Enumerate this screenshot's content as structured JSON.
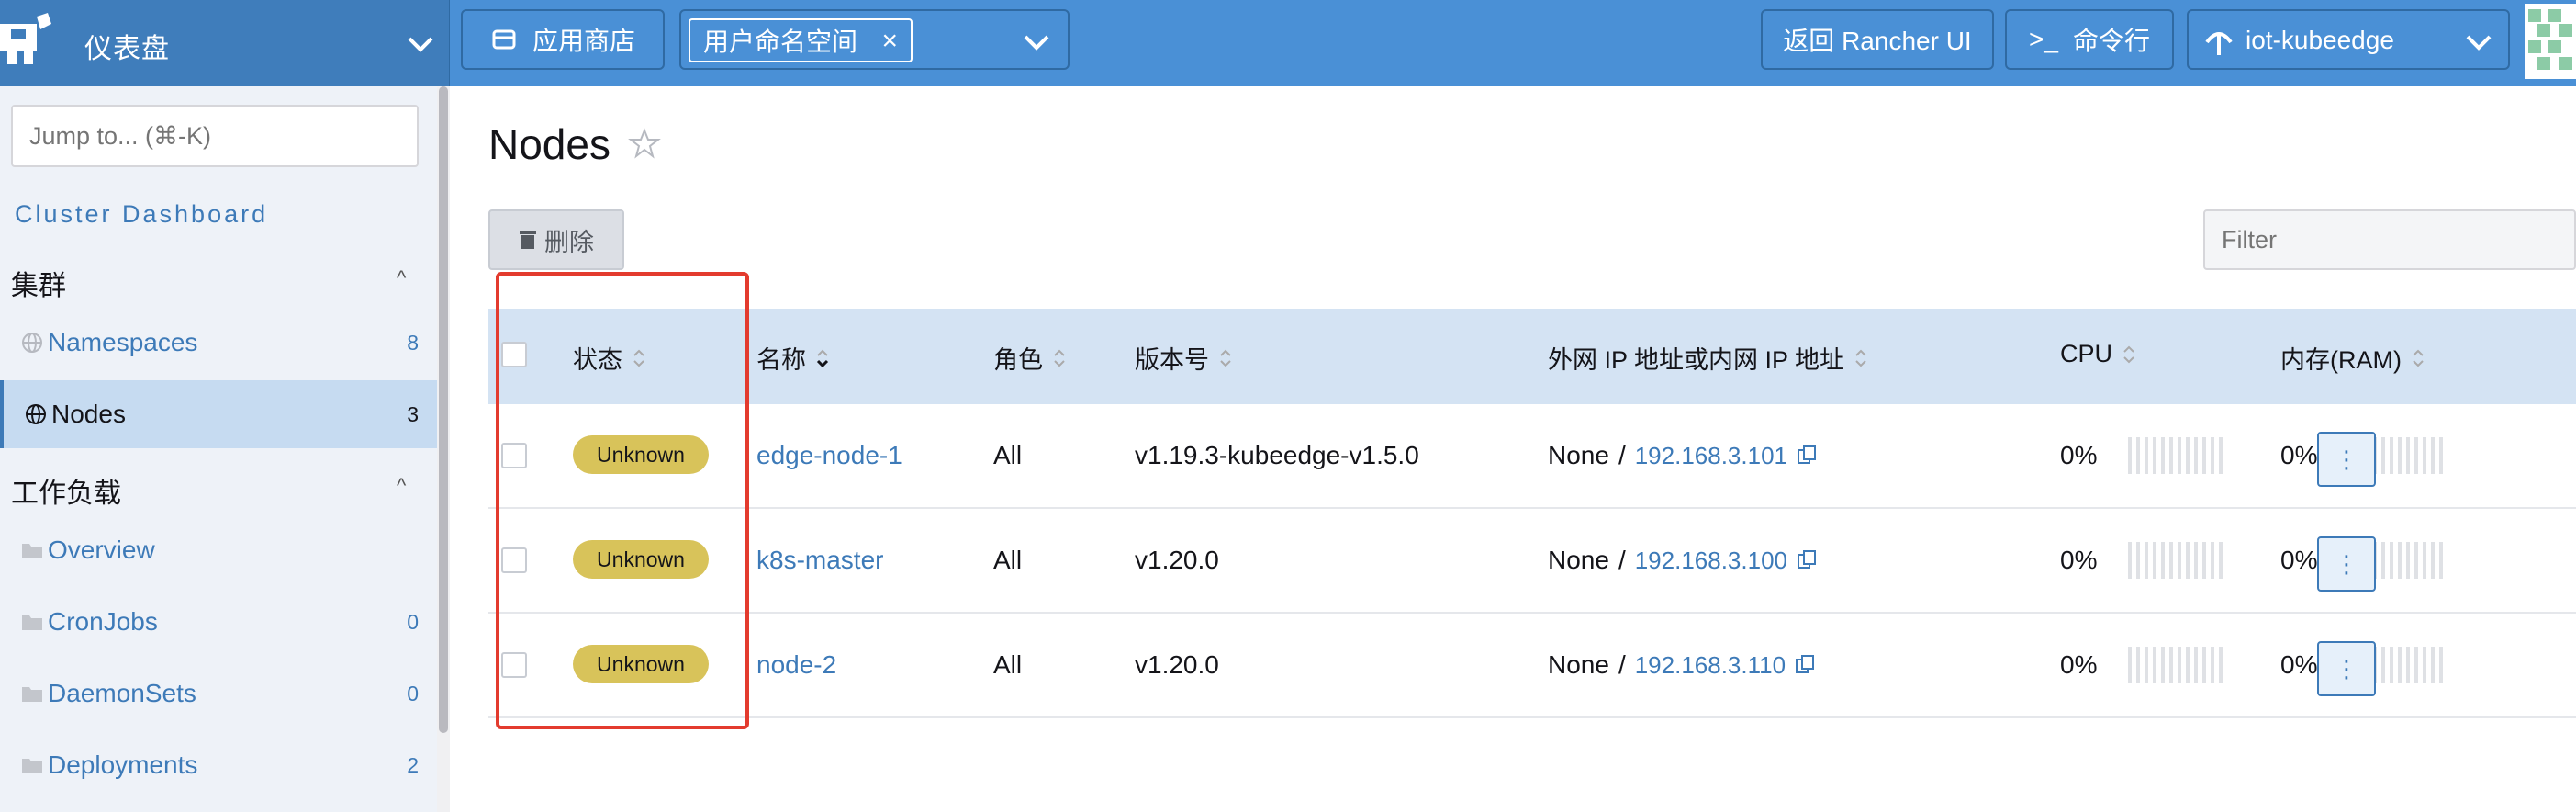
{
  "header": {
    "brand_label": "仪表盘",
    "app_store_label": "应用商店",
    "namespace_chip": "用户命名空间",
    "chip_close": "×",
    "back_label": "返回 Rancher UI",
    "shell_label": "命令行",
    "cluster_name": "iot-kubeedge"
  },
  "sidebar": {
    "jump_placeholder": "Jump to... (⌘-K)",
    "dashboard_link": "Cluster Dashboard",
    "groups": [
      {
        "label": "集群",
        "items": [
          {
            "label": "Namespaces",
            "count": "8",
            "icon": "globe-icon"
          },
          {
            "label": "Nodes",
            "count": "3",
            "icon": "globe-icon",
            "active": true
          }
        ]
      },
      {
        "label": "工作负载",
        "items": [
          {
            "label": "Overview",
            "count": "",
            "icon": "folder-icon"
          },
          {
            "label": "CronJobs",
            "count": "0",
            "icon": "folder-icon"
          },
          {
            "label": "DaemonSets",
            "count": "0",
            "icon": "folder-icon"
          },
          {
            "label": "Deployments",
            "count": "2",
            "icon": "folder-icon"
          }
        ]
      }
    ]
  },
  "main": {
    "title": "Nodes",
    "delete_label": "删除",
    "filter_placeholder": "Filter",
    "columns": {
      "state": "状态",
      "name": "名称",
      "role": "角色",
      "version": "版本号",
      "ip": "外网 IP 地址或内网 IP 地址",
      "cpu": "CPU",
      "ram": "内存(RAM)"
    },
    "rows": [
      {
        "state": "Unknown",
        "name": "edge-node-1",
        "role": "All",
        "version": "v1.19.3-kubeedge-v1.5.0",
        "external_ip": "None",
        "sep": "/",
        "internal_ip": "192.168.3.101",
        "cpu": "0%",
        "ram": "0%"
      },
      {
        "state": "Unknown",
        "name": "k8s-master",
        "role": "All",
        "version": "v1.20.0",
        "external_ip": "None",
        "sep": "/",
        "internal_ip": "192.168.3.100",
        "cpu": "0%",
        "ram": "0%"
      },
      {
        "state": "Unknown",
        "name": "node-2",
        "role": "All",
        "version": "v1.20.0",
        "external_ip": "None",
        "sep": "/",
        "internal_ip": "192.168.3.110",
        "cpu": "0%",
        "ram": "0%"
      }
    ],
    "kebab_glyph": "⋮"
  },
  "colors": {
    "header_bg": "#4a90d6",
    "link": "#3d7ab8",
    "badge_unknown": "#d8c35a",
    "highlight_box": "#e33b2e"
  }
}
